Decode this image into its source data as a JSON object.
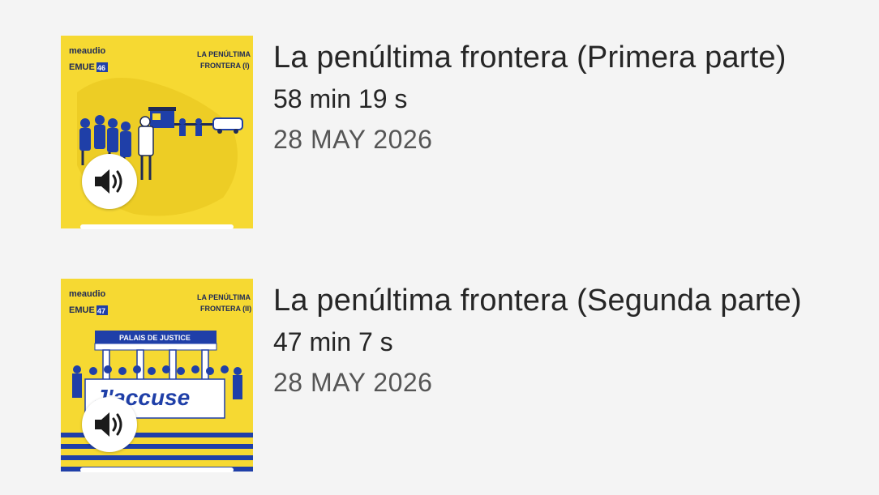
{
  "colors": {
    "background": "#f4f4f4",
    "thumbnail_yellow": "#f6d932",
    "thumbnail_blue": "#1f3fa8",
    "text_primary": "#262626",
    "text_secondary": "#555555"
  },
  "episodes": [
    {
      "title": "La penúltima frontera (Primera parte)",
      "duration": "58 min 19 s",
      "date": "28 MAY 2026",
      "thumbnail": {
        "brand": "meaudio",
        "series": "EMUE",
        "number": "46",
        "caption_line1": "LA PENÚLTIMA",
        "caption_line2": "FRONTERA (I)"
      },
      "play_icon": "speaker-icon"
    },
    {
      "title": "La penúltima frontera (Segunda parte)",
      "duration": "47 min 7 s",
      "date": "28 MAY 2026",
      "thumbnail": {
        "brand": "meaudio",
        "series": "EMUE",
        "number": "47",
        "caption_line1": "LA PENÚLTIMA",
        "caption_line2": "FRONTERA (II)",
        "building_sign": "PALAIS DE JUSTICE",
        "banner_text": "J'accuse"
      },
      "play_icon": "speaker-icon"
    }
  ]
}
